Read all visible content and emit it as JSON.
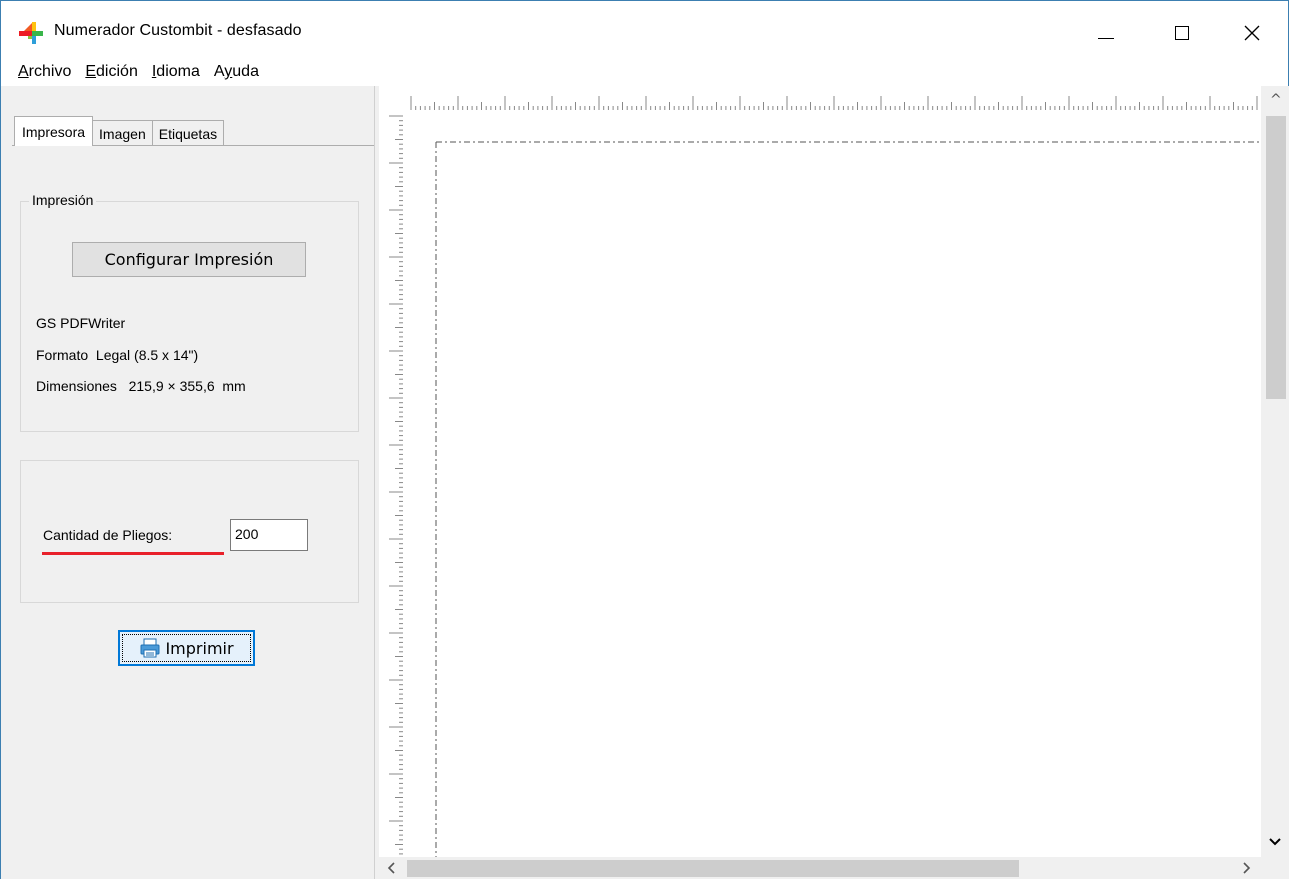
{
  "window": {
    "title": "Numerador Custombit - desfasado",
    "icon": "app-logo-icon",
    "controls": [
      "minimize-icon",
      "maximize-icon",
      "close-icon"
    ]
  },
  "menu": {
    "items": [
      {
        "key": "A",
        "rest": "rchivo"
      },
      {
        "key": "E",
        "rest": "dición"
      },
      {
        "key": "I",
        "rest": "dioma"
      },
      {
        "pre": "A",
        "key": "y",
        "rest": "uda"
      }
    ]
  },
  "tabs": [
    {
      "label": "Impresora",
      "active": true
    },
    {
      "label": "Imagen",
      "active": false
    },
    {
      "label": "Etiquetas",
      "active": false
    }
  ],
  "print_group": {
    "legend": "Impresión",
    "configure_button": "Configurar Impresión",
    "printer_name": "GS PDFWriter",
    "format_line": "Formato  Legal (8.5 x 14\")",
    "dimensions_line": "Dimensiones   215,9 × 355,6  mm"
  },
  "sheets": {
    "label": "Cantidad de Pliegos:",
    "value": "200"
  },
  "print_button": {
    "label": "Imprimir",
    "icon": "printer-icon"
  },
  "colors": {
    "accent": "#0078d7",
    "highlight_underline": "#e8202a",
    "panel_bg": "#f0f0f0"
  }
}
